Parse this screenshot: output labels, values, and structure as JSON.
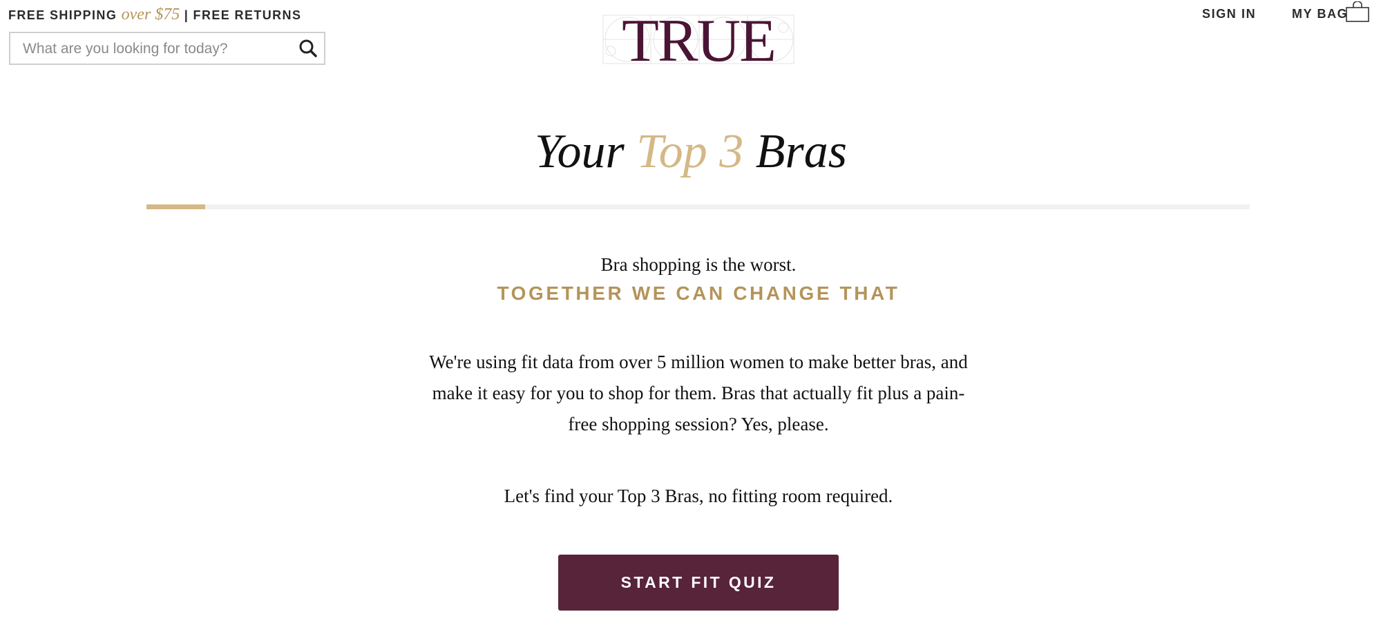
{
  "promo": {
    "shipping_label": "FREE SHIPPING",
    "threshold": "over $75",
    "separator": "|",
    "returns_label": "FREE RETURNS"
  },
  "search": {
    "placeholder": "What are you looking for today?",
    "value": "",
    "icon": "search-icon"
  },
  "brand": {
    "logo_text": "TRUE",
    "logo_color": "#4a1535"
  },
  "nav": {
    "sign_in": "SIGN IN",
    "bag_label": "MY BAG",
    "bag_icon": "shopping-bag-icon"
  },
  "hero": {
    "title_part1": "Your",
    "title_highlight": "Top 3",
    "title_part2": "Bras",
    "progress": 0.053
  },
  "content": {
    "tagline": "Bra shopping is the worst.",
    "subhead": "TOGETHER WE CAN CHANGE THAT",
    "body_line1": "We're using fit data from over 5 million women to make better bras, and",
    "body_line2": "make it easy for you to shop for them. Bras that actually fit plus a pain-",
    "body_line3": "free shopping session? Yes, please.",
    "cta_note": "Let's find your Top 3 Bras, no fitting room required.",
    "cta_label": "START FIT QUIZ"
  },
  "colors": {
    "accent_gold": "#d4b886",
    "subhead_gold": "#b4945a",
    "button_plum": "#58243a",
    "track": "#f1f1f1"
  }
}
